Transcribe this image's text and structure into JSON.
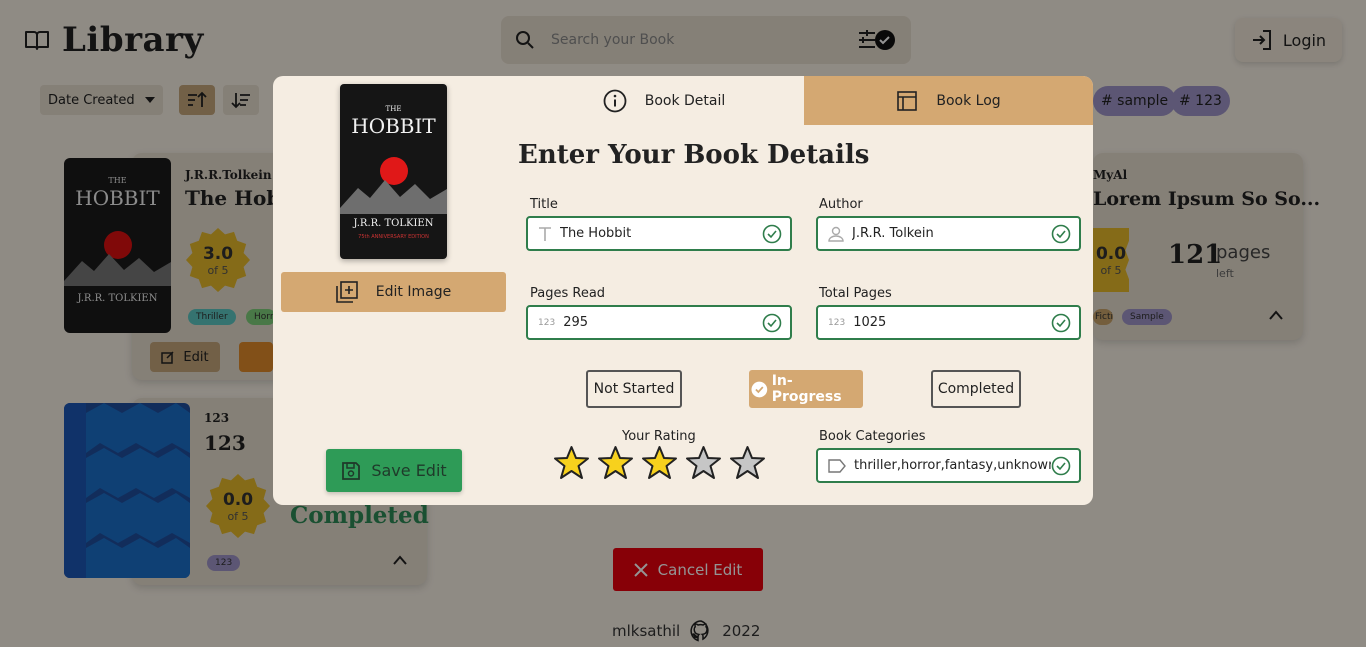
{
  "app": {
    "title": "Library",
    "login_label": "Login"
  },
  "search": {
    "placeholder": "Search your Book"
  },
  "toolbar": {
    "sort_label": "Date Created",
    "tags": [
      "# sample",
      "# 123"
    ]
  },
  "cards": [
    {
      "author": "J.R.R.Tolkein",
      "title": "The Hobbit",
      "rating": "3.0",
      "of": "of 5",
      "tags": [
        "Thriller",
        "Horror"
      ],
      "edit_label": "Edit"
    },
    {
      "author": "MyAl",
      "title": "Lorem Ipsum So So...",
      "rating": "0.0",
      "of": "of 5",
      "pages": "121",
      "pages_label": "pages",
      "pages_sub": "left",
      "tags": [
        "Fiction",
        "Sample"
      ]
    },
    {
      "author": "123",
      "title": "123",
      "rating": "0.0",
      "of": "of 5",
      "status": "Completed",
      "tags": [
        "123"
      ]
    }
  ],
  "cancel_label": "Cancel Edit",
  "footer": {
    "user": "mlksathil",
    "year": "2022"
  },
  "cover": {
    "title_top": "THE",
    "title_main": "HOBBIT",
    "author": "J.R.R. TOLKIEN",
    "edition": "75th ANNIVERSARY EDITION"
  },
  "modal": {
    "tabs": [
      {
        "label": "Book Detail",
        "active": true
      },
      {
        "label": "Book Log",
        "active": false
      }
    ],
    "heading": "Enter Your Book Details",
    "edit_image_label": "Edit Image",
    "save_label": "Save Edit",
    "fields": {
      "title": {
        "label": "Title",
        "value": "The Hobbit"
      },
      "author": {
        "label": "Author",
        "value": "J.R.R. Tolkein"
      },
      "pages_read": {
        "label": "Pages Read",
        "value": "295",
        "prefix": "123"
      },
      "total_pages": {
        "label": "Total Pages",
        "value": "1025",
        "prefix": "123"
      },
      "categories": {
        "label": "Book Categories",
        "value": "thriller,horror,fantasy,unknown"
      }
    },
    "status_options": [
      "Not Started",
      "In-Progress",
      "Completed"
    ],
    "selected_status": "In-Progress",
    "rating": {
      "label": "Your Rating",
      "value": 3,
      "max": 5
    }
  },
  "colors": {
    "accent": "#d4a872",
    "success": "#2e9b57",
    "danger": "#e8000d",
    "star_filled": "#f7d11d",
    "star_empty": "#c6c6c6"
  }
}
